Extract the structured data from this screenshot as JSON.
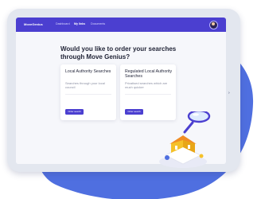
{
  "navbar": {
    "logo_text": "MoveGenius",
    "links": [
      "Dashboard",
      "My links",
      "Documents"
    ],
    "active_link": "My links"
  },
  "main": {
    "headline": "Would you like to order your searches through Move Genius?"
  },
  "cards": [
    {
      "title": "Local Authority Searches",
      "description": "Searches through your local council",
      "button_label": "Order search"
    },
    {
      "title": "Regulated Local Authority Searches",
      "description": "Privatised searches which are much quicker",
      "button_label": "Order search"
    }
  ],
  "colors": {
    "brand_primary": "#4b3fd0",
    "blob": "#4f6fe0",
    "house_yellow": "#f5c12a"
  },
  "icons": [
    "avatar",
    "magnifying-glass-house-illustration",
    "chevron-right-icon"
  ]
}
